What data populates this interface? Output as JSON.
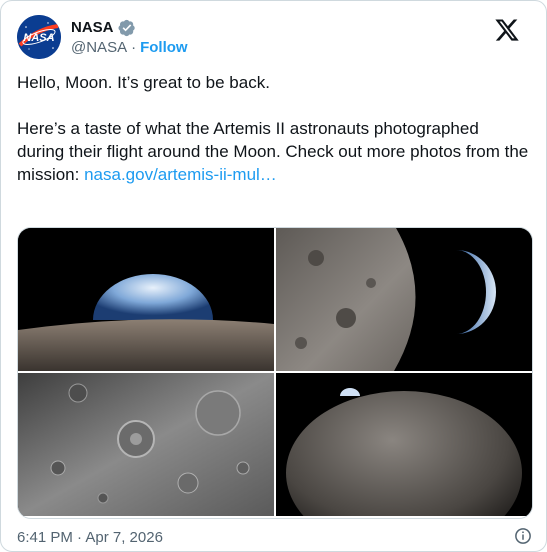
{
  "author": {
    "display_name": "NASA",
    "handle": "@NASA",
    "separator": "·",
    "follow_label": "Follow",
    "avatar_text": "NASA"
  },
  "icons": {
    "verified": "verified-badge-icon",
    "platform": "x-logo-icon",
    "info": "info-icon"
  },
  "tweet": {
    "line1": "Hello, Moon. It’s great to be back.",
    "line2_text": "Here’s a taste of what the Artemis II astronauts photographed during their flight around the Moon. Check out more photos from the mission: ",
    "link_text": "nasa.gov/artemis-ii-mul…"
  },
  "media": [
    {
      "subject": "earth-over-lunar-horizon"
    },
    {
      "subject": "crescent-earth-beside-moon"
    },
    {
      "subject": "lunar-craters-closeup"
    },
    {
      "subject": "earth-peeking-over-moon"
    }
  ],
  "timestamp": "6:41 PM · Apr 7, 2026",
  "colors": {
    "accent": "#1d9bf0",
    "verified": "#829aab",
    "text": "#0f1419",
    "secondary": "#536471"
  }
}
